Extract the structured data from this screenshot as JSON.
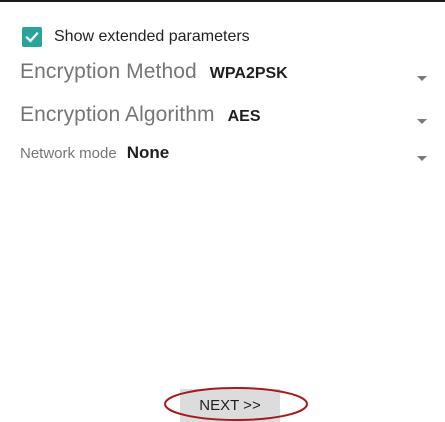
{
  "settings": {
    "show_extended": {
      "label": "Show extended parameters",
      "checked": true
    },
    "encryption_method": {
      "label": "Encryption Method",
      "value": "WPA2PSK"
    },
    "encryption_algorithm": {
      "label": "Encryption Algorithm",
      "value": "AES"
    },
    "network_mode": {
      "label": "Network mode",
      "value": "None"
    }
  },
  "footer": {
    "next_label": "NEXT >>"
  },
  "colors": {
    "checkbox": "#2aa39a",
    "annotation_oval": "#a31b1b",
    "button_bg": "#dcdcdc"
  },
  "icons": {
    "check": "check-icon",
    "dropdown": "dropdown-arrow-icon"
  }
}
